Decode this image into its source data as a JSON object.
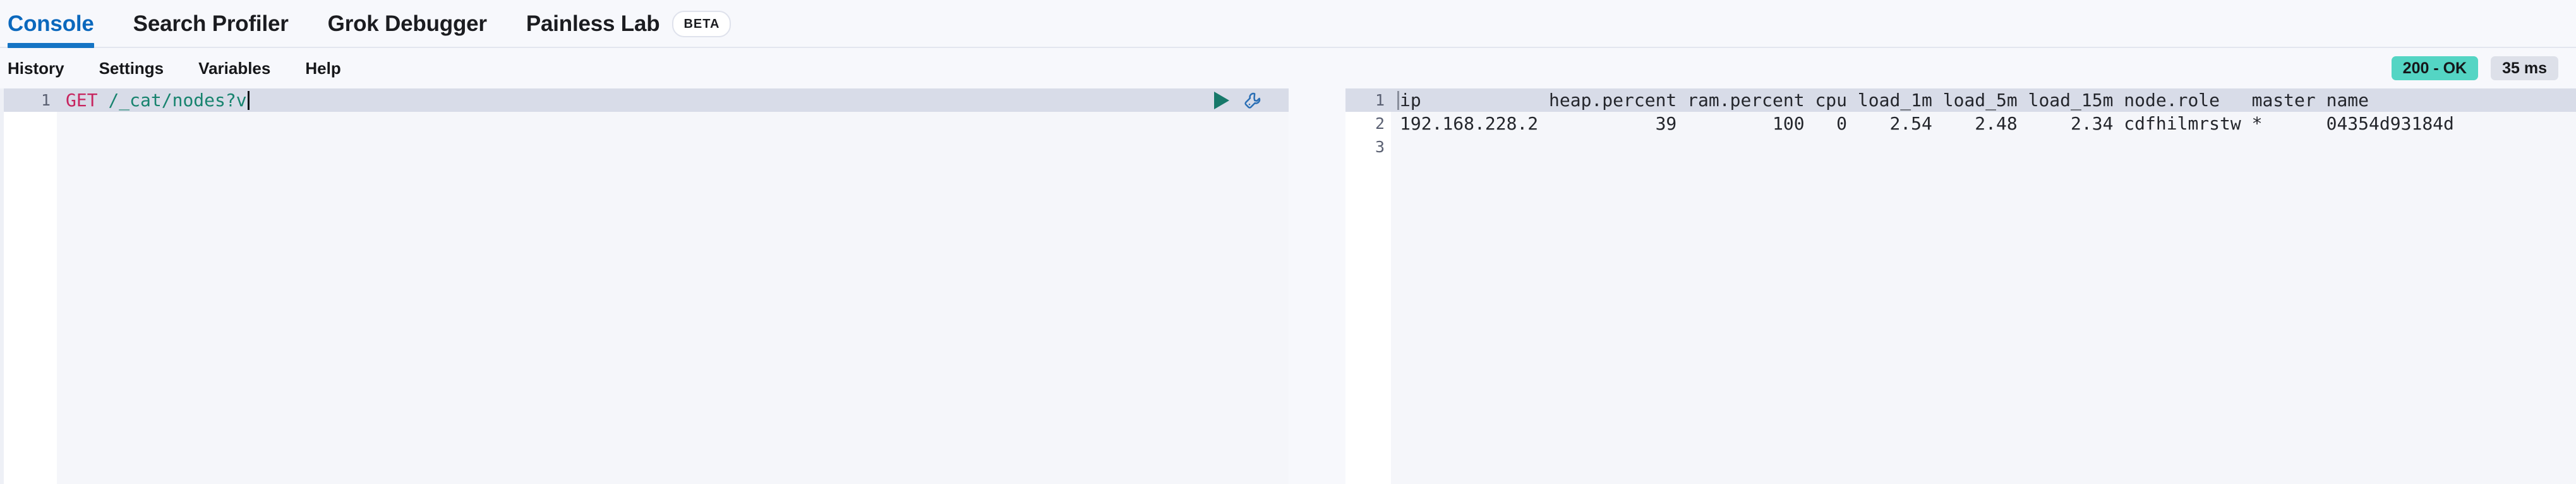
{
  "tabs": [
    {
      "label": "Console",
      "active": true,
      "badge": null
    },
    {
      "label": "Search Profiler",
      "active": false,
      "badge": null
    },
    {
      "label": "Grok Debugger",
      "active": false,
      "badge": null
    },
    {
      "label": "Painless Lab",
      "active": false,
      "badge": "BETA"
    }
  ],
  "toolbar": {
    "items": [
      {
        "label": "History"
      },
      {
        "label": "Settings"
      },
      {
        "label": "Variables"
      },
      {
        "label": "Help"
      }
    ],
    "status_badge": "200 - OK",
    "time_badge": "35 ms",
    "status_color": "#54d5c4",
    "time_color": "#dde0e9"
  },
  "editor": {
    "line_numbers": [
      "1"
    ],
    "request": {
      "method": "GET",
      "path": "/_cat/nodes?v"
    },
    "method_color": "#c7255f",
    "path_color": "#17836e",
    "actions": [
      {
        "name": "play-icon",
        "title": "Click to send request"
      },
      {
        "name": "wrench-icon",
        "title": "Open documentation"
      }
    ]
  },
  "output": {
    "line_numbers": [
      "1",
      "2",
      "3"
    ],
    "lines": [
      "ip            heap.percent ram.percent cpu load_1m load_5m load_15m node.role   master name",
      "192.168.228.2           39         100   0    2.54    2.48     2.34 cdfhilmrstw *      04354d93184d",
      ""
    ],
    "columns": [
      "ip",
      "heap.percent",
      "ram.percent",
      "cpu",
      "load_1m",
      "load_5m",
      "load_15m",
      "node.role",
      "master",
      "name"
    ],
    "rows": [
      {
        "ip": "192.168.228.2",
        "heap.percent": "39",
        "ram.percent": "100",
        "cpu": "0",
        "load_1m": "2.54",
        "load_5m": "2.48",
        "load_15m": "2.34",
        "node.role": "cdfhilmrstw",
        "master": "*",
        "name": "04354d93184d"
      }
    ]
  }
}
